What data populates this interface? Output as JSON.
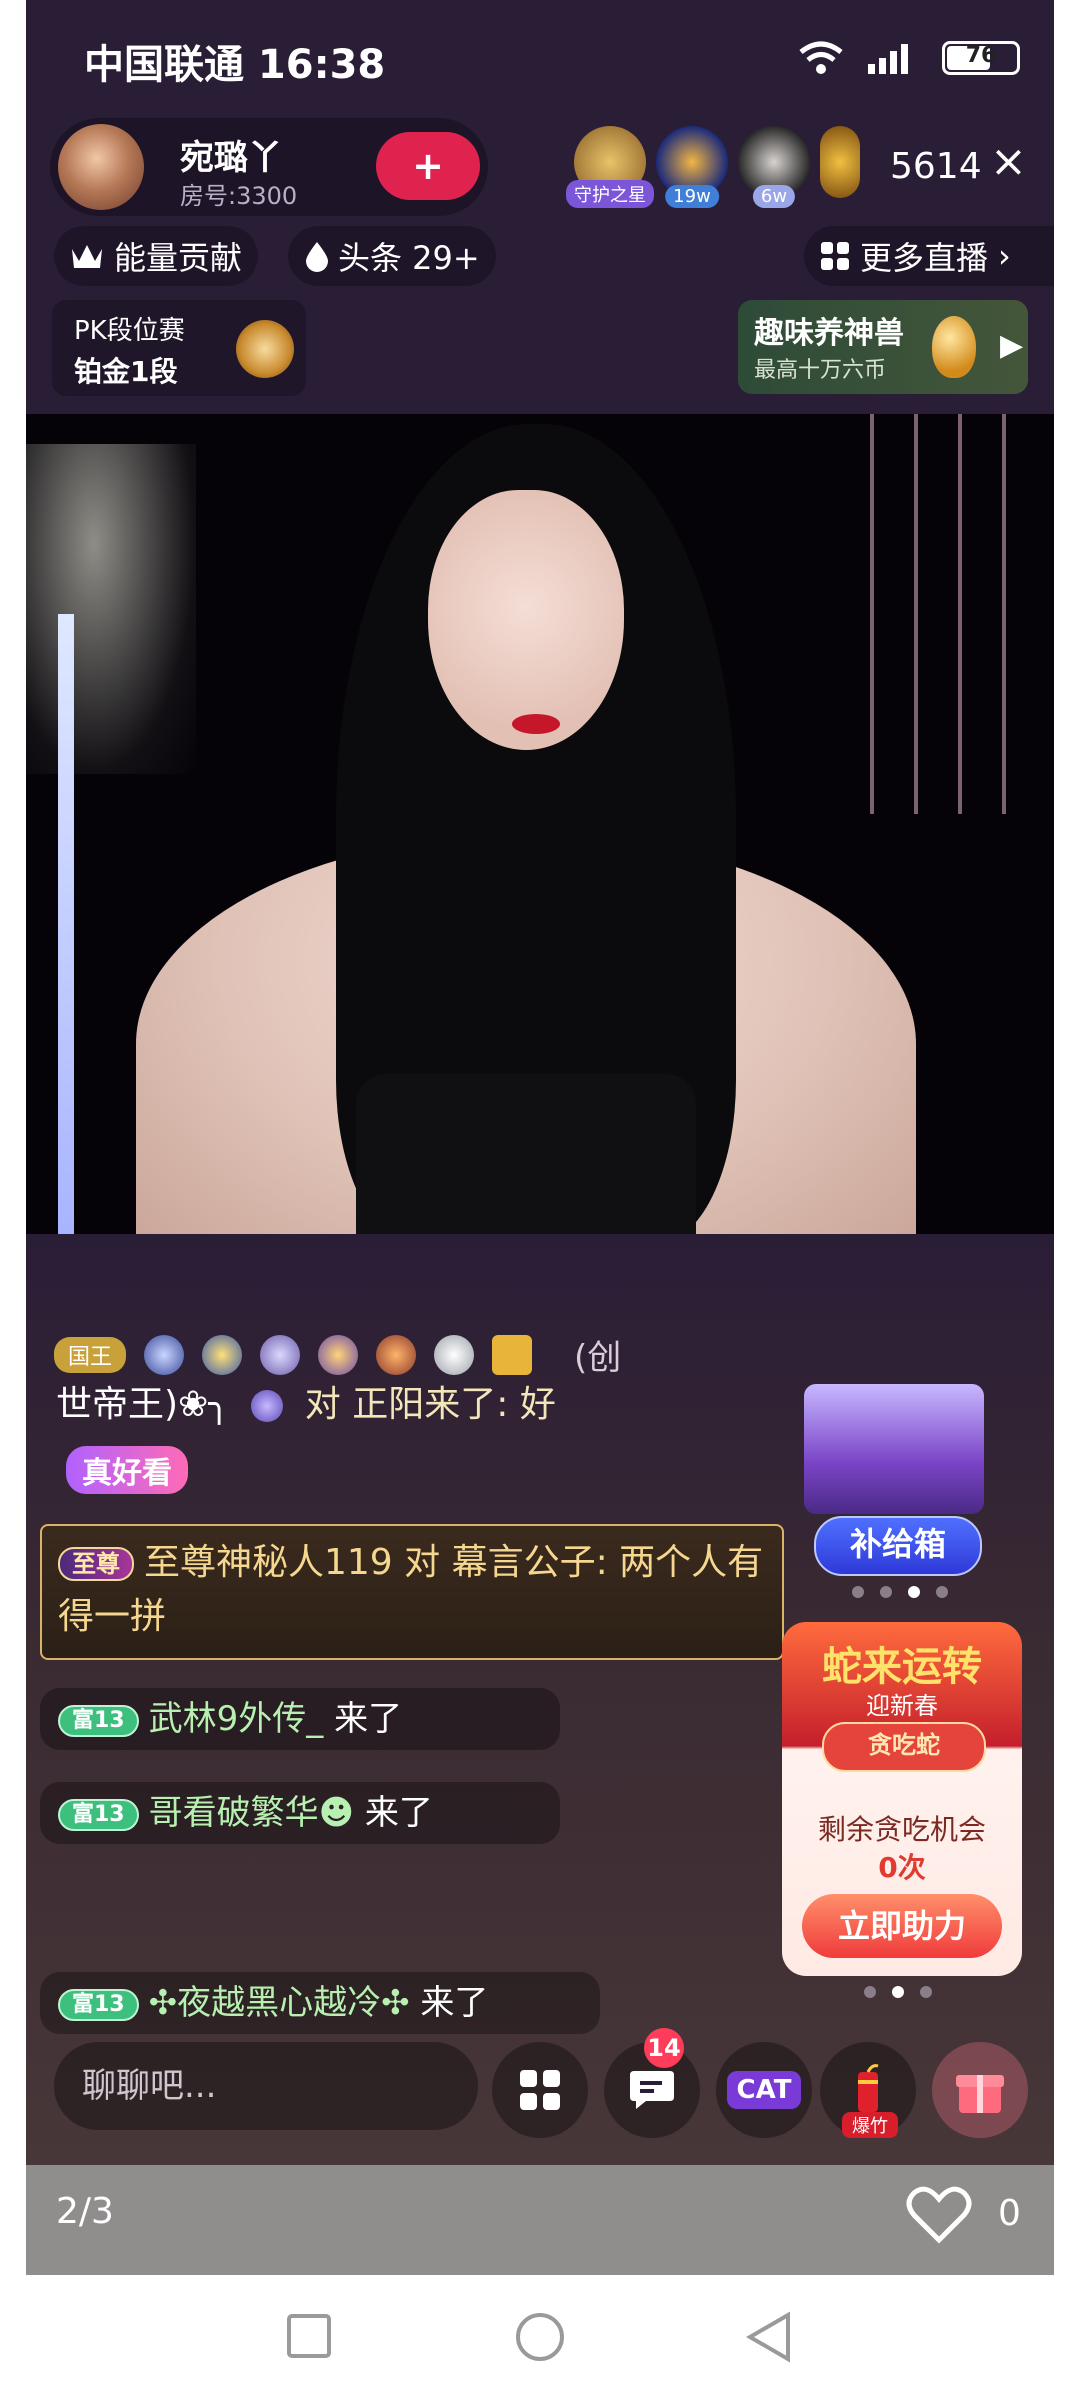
{
  "status_bar": {
    "carrier_time": "中国联通 16:38",
    "battery": "76"
  },
  "host": {
    "name": "宛璐丫",
    "room": "房号:3300",
    "follow_label": "+"
  },
  "viewers": {
    "badges": [
      "守护之星",
      "19w",
      "6w"
    ],
    "count": "5614",
    "close_label": "×"
  },
  "tabs": {
    "energy": "能量贡献",
    "headline": "头条 29+",
    "more_live": "更多直播"
  },
  "pk": {
    "line1": "PK段位赛",
    "line2": "铂金1段"
  },
  "pet_promo": {
    "title": "趣味养神兽",
    "subtitle": "最高十万六币"
  },
  "chat": {
    "king_badge": "国王",
    "line_tail": "(创",
    "line2": "世帝王)❀╮",
    "line2_action": "对 正阳来了: 好",
    "line3": "真好看",
    "supreme_tag": "至尊",
    "supreme_text": "至尊神秘人119 对 幕言公子: 两个人有得一拼",
    "rich_label": "富13",
    "m1_name": "武林9外传_",
    "m2_name": "哥看破繁华☻",
    "m3_name": "✣夜越黑心越冷✣",
    "came": "来了"
  },
  "side": {
    "supply_label": "补给箱",
    "snake_title": "蛇来运转",
    "snake_sub": "迎新春",
    "snake_chip": "贪吃蛇",
    "snake_line1": "剩余贪吃机会",
    "snake_line2": "0次",
    "snake_button": "立即助力"
  },
  "bottom": {
    "chat_placeholder": "聊聊吧...",
    "message_count": "14",
    "cat_label": "CAT",
    "cracker_label": "爆竹"
  },
  "overlay": {
    "page": "2/3",
    "likes": "0"
  }
}
